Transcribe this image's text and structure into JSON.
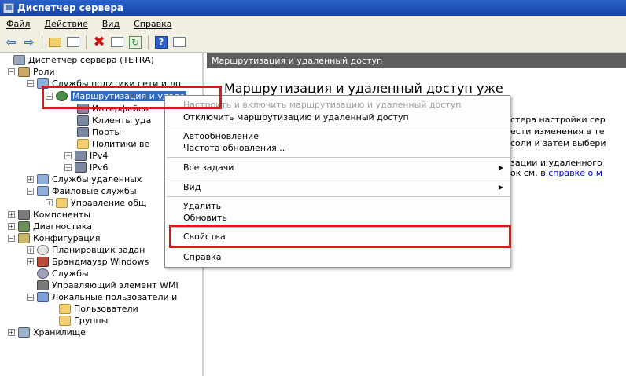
{
  "window": {
    "title": "Диспетчер сервера"
  },
  "menu": {
    "items": [
      "Файл",
      "Действие",
      "Вид",
      "Справка"
    ]
  },
  "tree": {
    "items": [
      {
        "label": "Диспетчер сервера (TETRA)"
      },
      {
        "label": "Роли"
      },
      {
        "label": "Службы политики сети и до"
      },
      {
        "label": "Маршрутизация и удале"
      },
      {
        "label": "Интерфейсы"
      },
      {
        "label": "Клиенты уда"
      },
      {
        "label": "Порты"
      },
      {
        "label": "Политики ве"
      },
      {
        "label": "IPv4"
      },
      {
        "label": "IPv6"
      },
      {
        "label": "Службы удаленных"
      },
      {
        "label": "Файловые службы"
      },
      {
        "label": "Управление общ"
      },
      {
        "label": "Компоненты"
      },
      {
        "label": "Диагностика"
      },
      {
        "label": "Конфигурация"
      },
      {
        "label": "Планировщик задан"
      },
      {
        "label": "Брандмауэр Windows"
      },
      {
        "label": "Службы"
      },
      {
        "label": "Управляющий элемент WMI"
      },
      {
        "label": "Локальные пользователи и"
      },
      {
        "label": "Пользователи"
      },
      {
        "label": "Группы"
      },
      {
        "label": "Хранилище"
      }
    ]
  },
  "right": {
    "header": "Маршрутизация и удаленный доступ",
    "title": "Маршрутизация и удаленный доступ уже",
    "lines": [
      "стера настройки сер",
      "ести изменения в те",
      "соли и затем выбери",
      "зации и удаленного",
      "ок см. в"
    ],
    "link": "справке о м"
  },
  "context_menu": {
    "items": [
      {
        "label": "Настроить и включить маршрутизацию и удаленный доступ",
        "disabled": true
      },
      {
        "label": "Отключить маршрутизацию и удаленный доступ"
      },
      {
        "label": "Автообновление"
      },
      {
        "label": "Частота обновления..."
      },
      {
        "label": "Все задачи",
        "submenu": true
      },
      {
        "label": "Вид",
        "submenu": true
      },
      {
        "label": "Удалить"
      },
      {
        "label": "Обновить"
      },
      {
        "label": "Свойства"
      },
      {
        "label": "Справка"
      }
    ]
  },
  "colors": {
    "highlight_box": "#d61a1a",
    "selection": "#316ac5",
    "titlebar": "#1f52b8"
  }
}
